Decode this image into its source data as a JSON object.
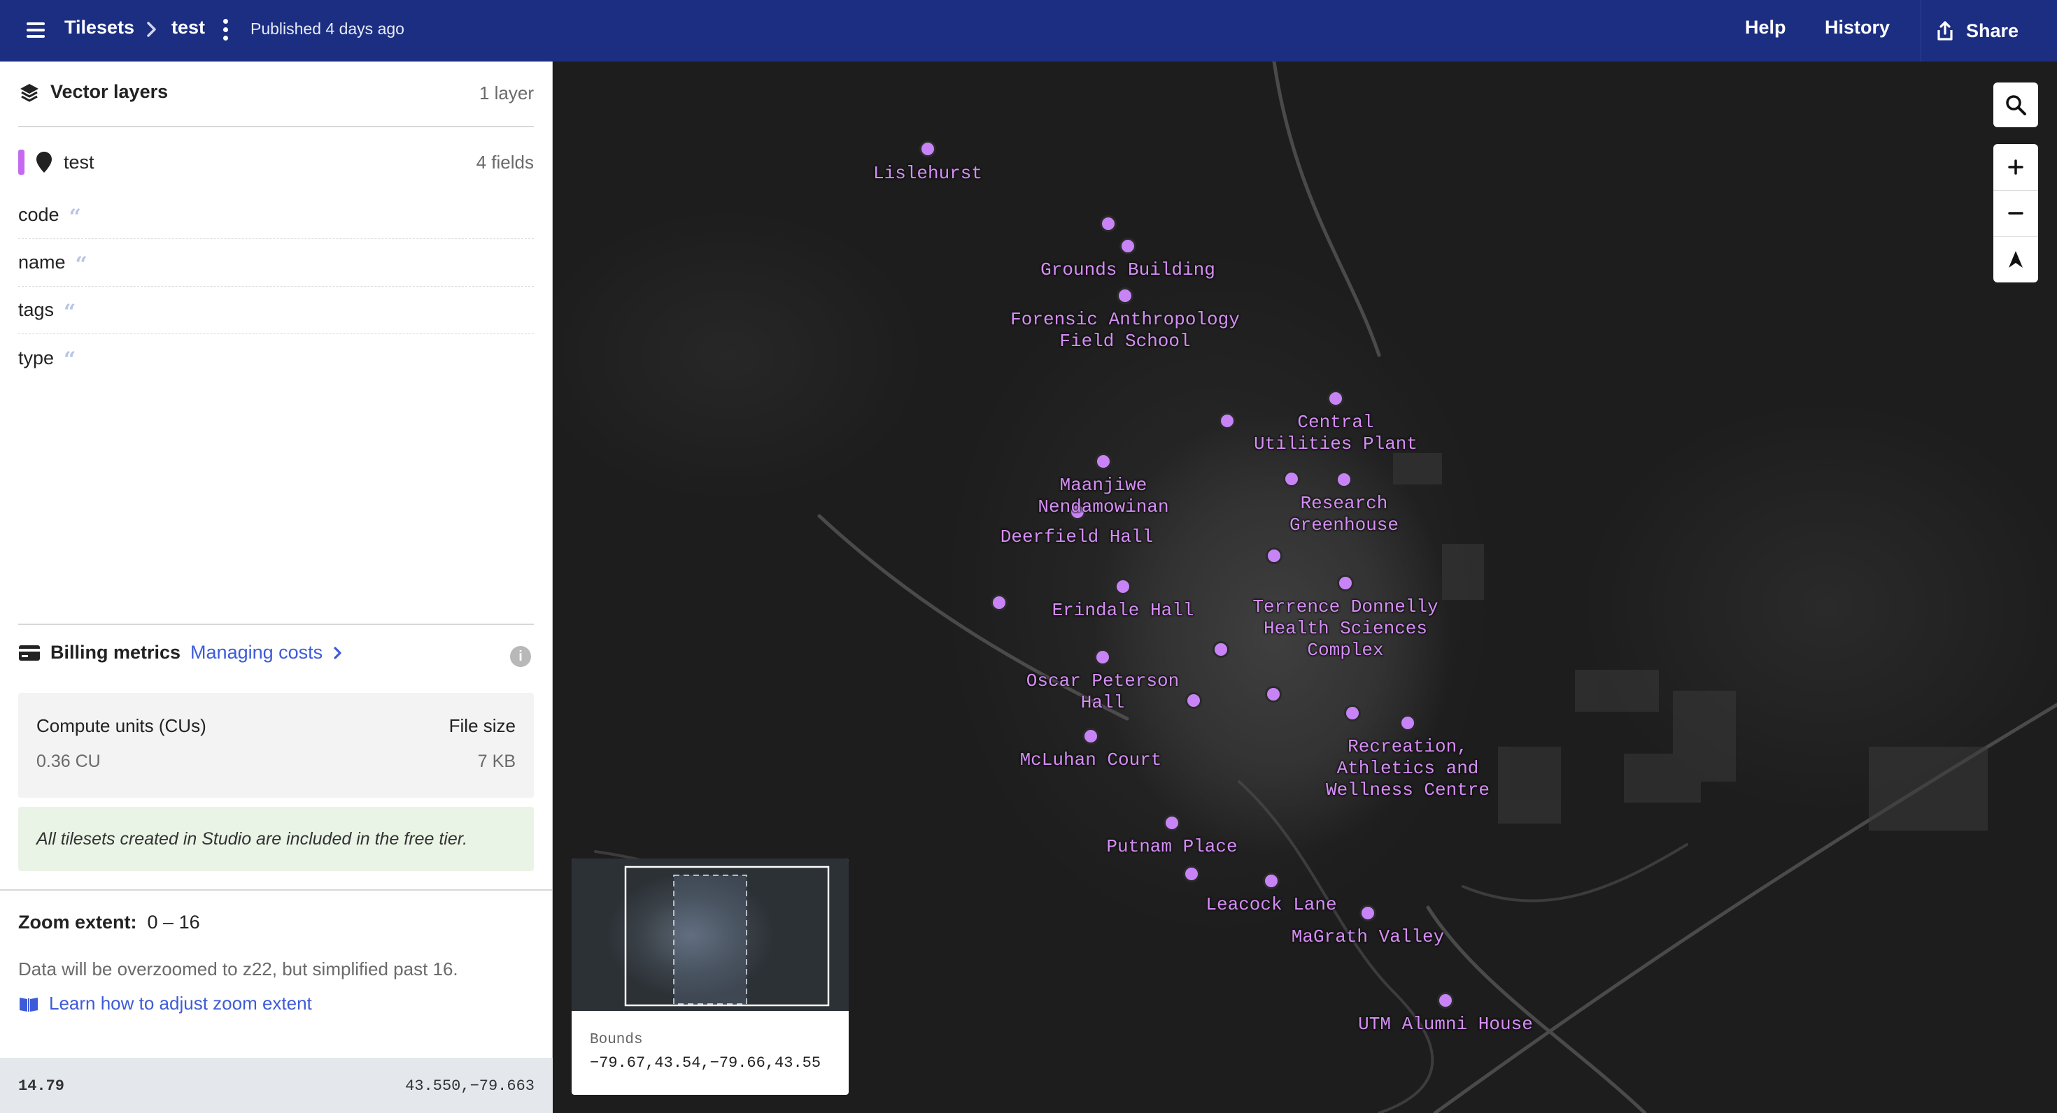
{
  "header": {
    "breadcrumb_root": "Tilesets",
    "breadcrumb_current": "test",
    "published": "Published 4 days ago",
    "help": "Help",
    "history": "History",
    "share": "Share",
    "bg_color": "#1b2e82"
  },
  "sidebar": {
    "vector_layers": {
      "title": "Vector layers",
      "count": "1 layer"
    },
    "layer": {
      "name": "test",
      "fields_count": "4 fields",
      "color": "#c56af0"
    },
    "fields": [
      {
        "name": "code",
        "icon": "quote-icon"
      },
      {
        "name": "name",
        "icon": "quote-icon"
      },
      {
        "name": "tags",
        "icon": "quote-icon"
      },
      {
        "name": "type",
        "icon": "quote-icon"
      }
    ],
    "billing": {
      "title": "Billing metrics",
      "link": "Managing costs",
      "compute_label": "Compute units (CUs)",
      "compute_value": "0.36 CU",
      "size_label": "File size",
      "size_value": "7 KB",
      "free_tier_note": "All tilesets created in Studio are included in the free tier."
    },
    "zoom": {
      "label": "Zoom extent:",
      "range": "0 – 16",
      "note": "Data will be overzoomed to z22, but simplified past 16.",
      "link": "Learn how to adjust zoom extent"
    },
    "status": {
      "zoom_level": "14.79",
      "coordinates": "43.550,−79.663"
    }
  },
  "map": {
    "poi_color": "#c884f7",
    "label_color": "#d58ef5",
    "labels": [
      {
        "text": "Lislehurst"
      },
      {
        "text": "Grounds Building"
      },
      {
        "text": "Forensic Anthropology\nField School"
      },
      {
        "text": "Central\nUtilities Plant"
      },
      {
        "text": "Maanjiwe\nNendamowinan"
      },
      {
        "text": "Research\nGreenhouse"
      },
      {
        "text": "Deerfield Hall"
      },
      {
        "text": "Erindale Hall"
      },
      {
        "text": "Terrence Donnelly\nHealth Sciences\nComplex"
      },
      {
        "text": "Oscar Peterson\nHall"
      },
      {
        "text": "McLuhan Court"
      },
      {
        "text": "Recreation,\nAthletics and\nWellness Centre"
      },
      {
        "text": "Putnam Place"
      },
      {
        "text": "Leacock Lane"
      },
      {
        "text": "MaGrath Valley"
      },
      {
        "text": "UTM Alumni House"
      }
    ],
    "minimap": {
      "label": "Bounds",
      "value": "−79.67,43.54,−79.66,43.55"
    }
  }
}
